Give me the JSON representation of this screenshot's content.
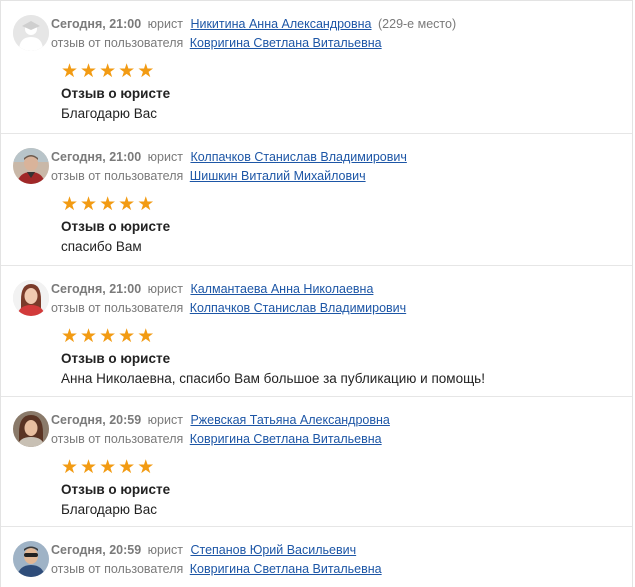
{
  "reviews": [
    {
      "date": "Сегодня, 21:00",
      "role": "юрист",
      "lawyer": "Никитина Анна Александровна",
      "rank": "(229-е место)",
      "from_label": "отзыв от пользователя",
      "user": "Ковригина Светлана Витальевна",
      "rating": 5,
      "title": "Отзыв о юристе",
      "text": "Благодарю Вас",
      "avatar": "default-user-avatar"
    },
    {
      "date": "Сегодня, 21:00",
      "role": "юрист",
      "lawyer": "Колпачков Станислав Владимирович",
      "rank": "",
      "from_label": "отзыв от пользователя",
      "user": "Шишкин Виталий Михайлович",
      "rating": 5,
      "title": "Отзыв о юристе",
      "text": "спасибо Вам",
      "avatar": "man-photo"
    },
    {
      "date": "Сегодня, 21:00",
      "role": "юрист",
      "lawyer": "Калмантаева Анна Николаевна",
      "rank": "",
      "from_label": "отзыв от пользователя",
      "user": "Колпачков Станислав Владимирович",
      "rating": 5,
      "title": "Отзыв о юристе",
      "text": "Анна Николаевна, спасибо Вам большое за публикацию и помощь!",
      "avatar": "woman-photo"
    },
    {
      "date": "Сегодня, 20:59",
      "role": "юрист",
      "lawyer": "Ржевская Татьяна Александровна",
      "rank": "",
      "from_label": "отзыв от пользователя",
      "user": "Ковригина Светлана Витальевна",
      "rating": 5,
      "title": "Отзыв о юристе",
      "text": "Благодарю Вас",
      "avatar": "woman-photo"
    },
    {
      "date": "Сегодня, 20:59",
      "role": "юрист",
      "lawyer": "Степанов Юрий Васильевич",
      "rank": "",
      "from_label": "отзыв от пользователя",
      "user": "Ковригина Светлана Витальевна",
      "avatar": "man-photo"
    }
  ],
  "colors": {
    "link": "#1d56a6",
    "star": "#f29b13",
    "muted": "#7a7a7a"
  },
  "icons": {
    "star": "★"
  }
}
